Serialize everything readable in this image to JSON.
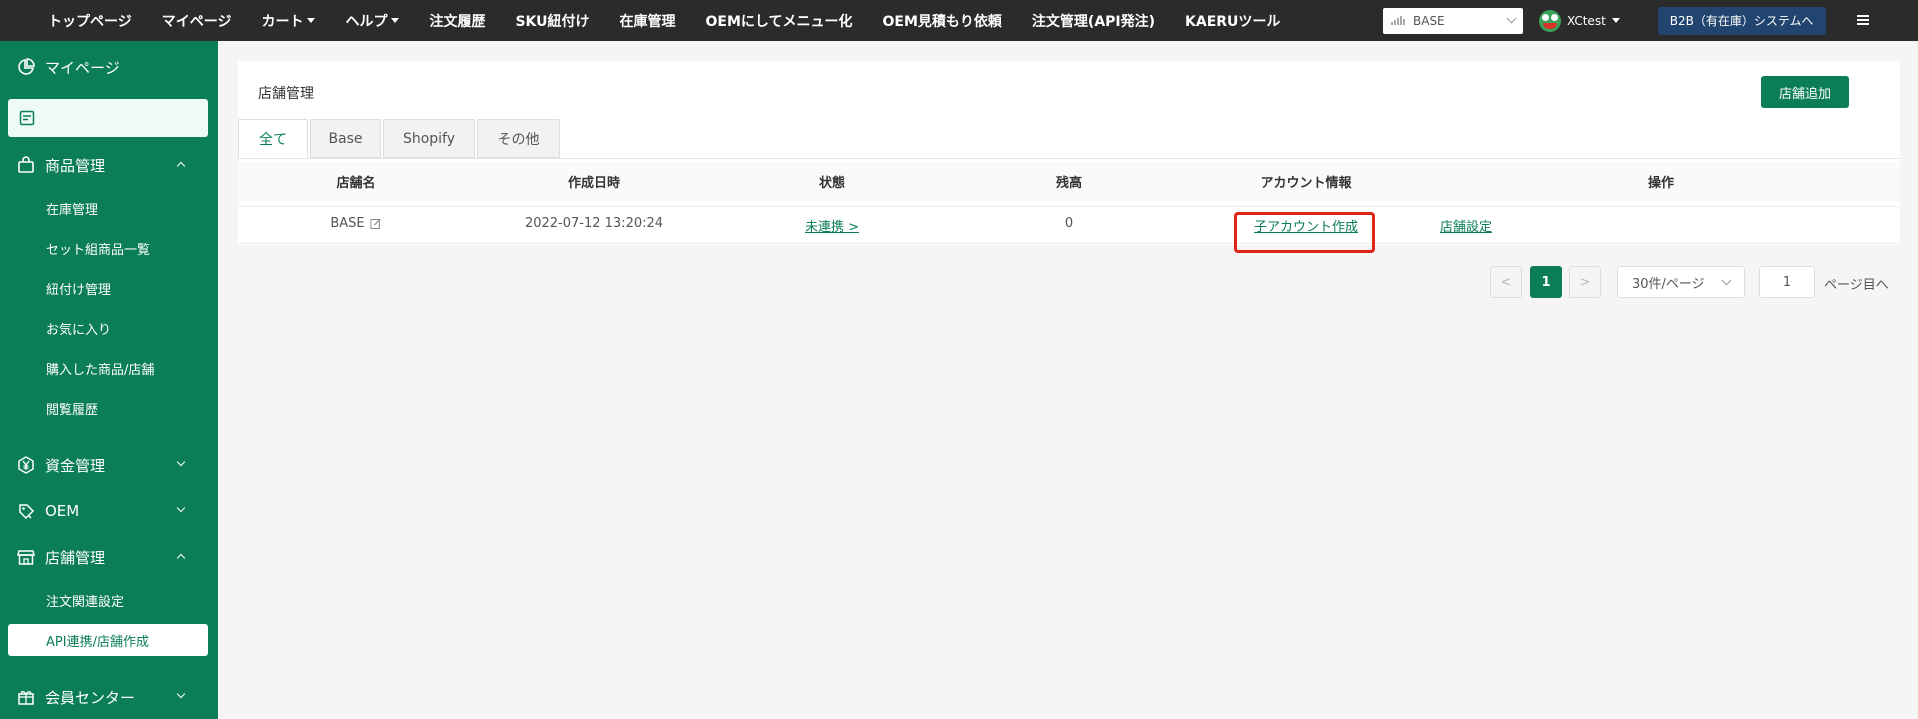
{
  "topnav": {
    "items": [
      {
        "label": "トップページ",
        "dropdown": false
      },
      {
        "label": "マイページ",
        "dropdown": false
      },
      {
        "label": "カート",
        "dropdown": true
      },
      {
        "label": "ヘルプ",
        "dropdown": true
      },
      {
        "label": "注文履歴",
        "dropdown": false
      },
      {
        "label": "SKU紐付け",
        "dropdown": false
      },
      {
        "label": "在庫管理",
        "dropdown": false
      },
      {
        "label": "OEMにしてメニュー化",
        "dropdown": false
      },
      {
        "label": "OEM見積もり依頼",
        "dropdown": false
      },
      {
        "label": "注文管理(API発注)",
        "dropdown": false
      },
      {
        "label": "KAERUツール",
        "dropdown": false
      }
    ],
    "store_select": "BASE",
    "username": "XCtest",
    "b2b_button": "B2B（有在庫）システムへ"
  },
  "sidebar": {
    "mypage": "マイページ",
    "product_group": "商品管理",
    "product_items": [
      "在庫管理",
      "セット組商品一覧",
      "紐付け管理",
      "お気に入り",
      "購入した商品/店舗",
      "閲覧履歴"
    ],
    "funds": "資金管理",
    "oem": "OEM",
    "store_group": "店舗管理",
    "store_items": [
      "注文関連設定",
      "API連携/店舗作成"
    ],
    "member": "会員センター"
  },
  "main": {
    "title": "店舗管理",
    "add_button": "店舗追加",
    "tabs": [
      "全て",
      "Base",
      "Shopify",
      "その他"
    ],
    "columns": [
      "店舗名",
      "作成日時",
      "状態",
      "残高",
      "アカウント情報",
      "操作"
    ],
    "row": {
      "store_name": "BASE",
      "created_at": "2022-07-12 13:20:24",
      "status": "未連携 >",
      "balance": "0",
      "account_action": "子アカウント作成",
      "operation": "店舗設定"
    },
    "pagination": {
      "prev": "<",
      "current_page": "1",
      "next": ">",
      "per_page": "30件/ページ",
      "goto_value": "1",
      "goto_label": "ページ目へ"
    }
  },
  "colors": {
    "brand_green": "#0b7e58",
    "topbar": "#2b2b2b",
    "b2b_button": "#21456e",
    "highlight": "#e2231a"
  }
}
